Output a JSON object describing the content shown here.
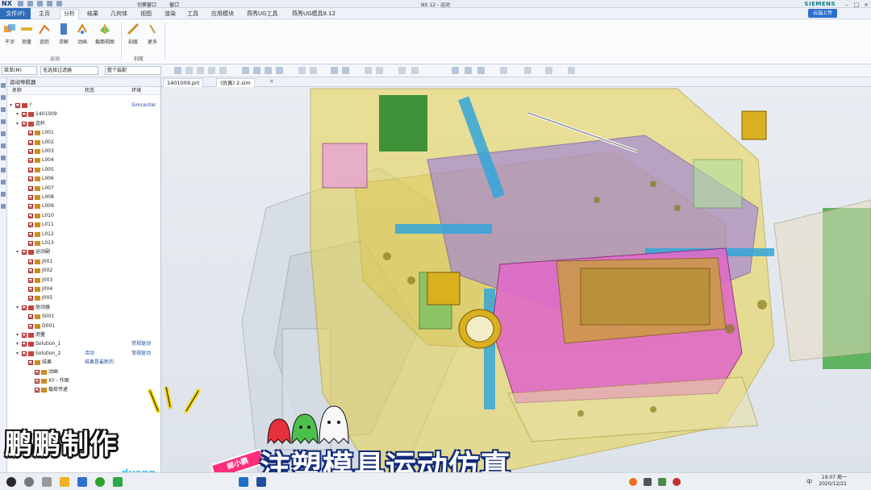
{
  "window": {
    "app": "NX",
    "title": "NX 12 - 运动",
    "brand": "SIEMENS",
    "quick_access": [
      "切换窗口",
      "窗口"
    ],
    "cloud_button": "云端上传"
  },
  "menu": {
    "file": "文件(F)",
    "tabs": [
      "主页",
      "分析",
      "结果",
      "几何体",
      "视图",
      "渲染",
      "工具",
      "应用模块",
      "燕秀UG工具",
      "燕秀UG模具8.12"
    ]
  },
  "ribbon": {
    "group1_buttons": [
      "干涉",
      "测量",
      "追踪",
      "求解",
      "动画",
      "截面视图"
    ],
    "group1_label": "运动",
    "group2_buttons": [
      "刻度",
      "更多"
    ],
    "group2_label": "刻度"
  },
  "toolbar2": {
    "menu_dropdown": "菜单(M)",
    "filter_dropdown": "无选择过滤器",
    "assembly_dropdown": "整个装配"
  },
  "navigator": {
    "title": "运动导航器",
    "columns": [
      "名称",
      "状态",
      "环境"
    ],
    "rows": [
      {
        "label": "?",
        "env": "Simcenter",
        "indent": 0
      },
      {
        "label": "1401009",
        "indent": 1
      },
      {
        "label": "连杆",
        "indent": 1
      },
      {
        "label": "L001",
        "indent": 2
      },
      {
        "label": "L002",
        "indent": 2
      },
      {
        "label": "L003",
        "indent": 2
      },
      {
        "label": "L004",
        "indent": 2
      },
      {
        "label": "L005",
        "indent": 2
      },
      {
        "label": "L006",
        "indent": 2
      },
      {
        "label": "L007",
        "indent": 2
      },
      {
        "label": "L008",
        "indent": 2
      },
      {
        "label": "L009",
        "indent": 2
      },
      {
        "label": "L010",
        "indent": 2
      },
      {
        "label": "L011",
        "indent": 2
      },
      {
        "label": "L012",
        "indent": 2
      },
      {
        "label": "L013",
        "indent": 2
      },
      {
        "label": "运动副",
        "indent": 1
      },
      {
        "label": "J001",
        "indent": 2
      },
      {
        "label": "J002",
        "indent": 2
      },
      {
        "label": "J003",
        "indent": 2
      },
      {
        "label": "J004",
        "indent": 2
      },
      {
        "label": "J005",
        "indent": 2
      },
      {
        "label": "驱动器",
        "indent": 1
      },
      {
        "label": "S001",
        "indent": 2
      },
      {
        "label": "D001",
        "indent": 2
      },
      {
        "label": "测量",
        "indent": 1
      },
      {
        "label": "Solution_1",
        "env": "常规驱动",
        "indent": 1
      },
      {
        "label": "Solution_2",
        "state": "活动",
        "env": "常规驱动",
        "indent": 1
      },
      {
        "label": "结果",
        "state": "结果是最新的",
        "indent": 2
      },
      {
        "label": "动画",
        "indent": 3
      },
      {
        "label": "XY - 作图",
        "indent": 3
      },
      {
        "label": "载荷传递",
        "indent": 3
      }
    ]
  },
  "doc_tabs": [
    "1401009.prt",
    "(仿真) 2.sim"
  ],
  "overlay": {
    "brand": "鹏鹏制作",
    "brand_sub": "duang",
    "tag": "邮小鹏",
    "title": "注塑模具运动仿真"
  },
  "taskbar": {
    "time": "19:07 周一",
    "date": "2020/12/21",
    "ime": "中"
  },
  "colors": {
    "accent": "#2f6fba",
    "mold_yellow": "#e8d34a",
    "mold_pink": "#e06cc8",
    "mold_purple": "#9a7be0",
    "mold_blue": "#33a6d9",
    "mold_green": "#3ea73e"
  }
}
